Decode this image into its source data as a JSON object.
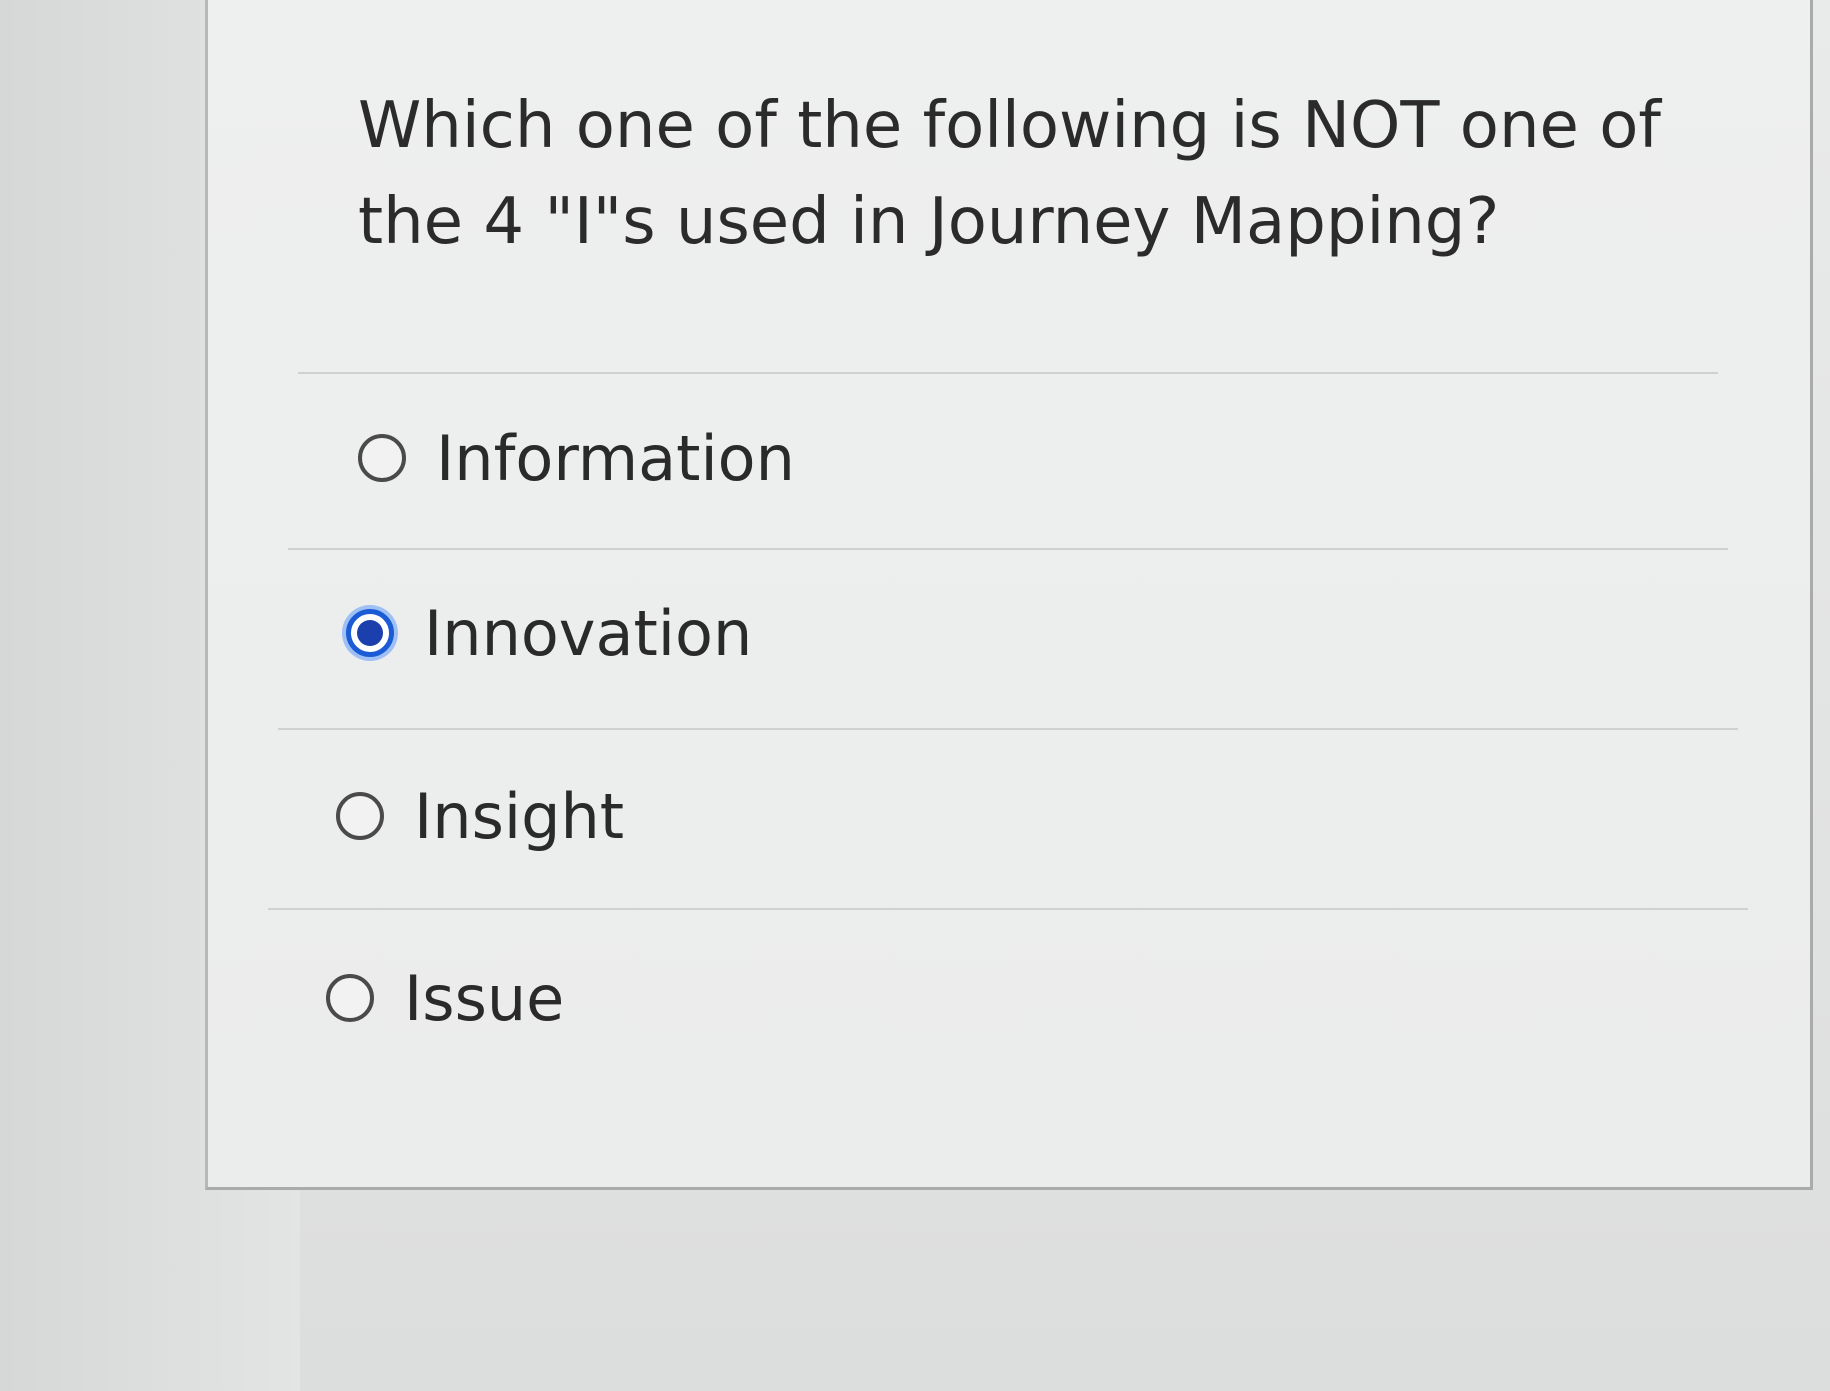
{
  "question": {
    "text": "Which one of the following is NOT one of the 4 \"I\"s used in Journey Mapping?"
  },
  "options": [
    {
      "label": "Information",
      "selected": false
    },
    {
      "label": "Innovation",
      "selected": true
    },
    {
      "label": "Insight",
      "selected": false
    },
    {
      "label": "Issue",
      "selected": false
    }
  ],
  "colors": {
    "selected_radio": "#1c5bd6",
    "text": "#2a2a2a",
    "background": "#e6e7e7"
  }
}
